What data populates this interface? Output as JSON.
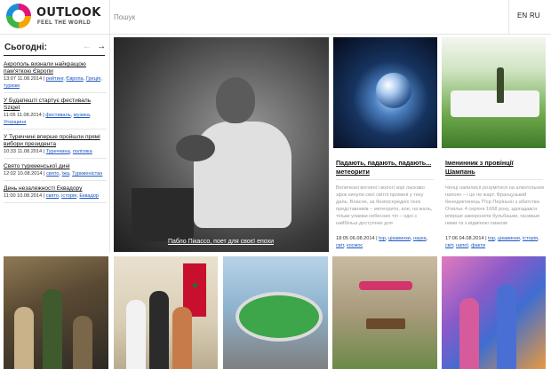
{
  "header": {
    "logo_title": "OUTLOOK",
    "logo_tagline": "FEEL THE WORLD",
    "search_placeholder": "Пошук",
    "languages": [
      "EN",
      "RU"
    ]
  },
  "sidebar": {
    "title": "Сьогодні:",
    "prev_icon": "←",
    "next_icon": "→",
    "items": [
      {
        "title": "Акрополь визнали найкращою пам'яткою Європи",
        "datetime": "13:07 11.08.2014",
        "tags": [
          "рейтинг",
          "Європа",
          "Греція",
          "туризм"
        ]
      },
      {
        "title": "У Будапешті стартує фестиваль Sziget",
        "datetime": "11:05 11.08.2014",
        "tags": [
          "фестиваль",
          "музика",
          "Угорщина"
        ]
      },
      {
        "title": "У Туреччині вперше пройшли прямі вибори президента",
        "datetime": "10:33 11.08.2014",
        "tags": [
          "Туреччина",
          "політика"
        ]
      },
      {
        "title": "Свято туркменської дині",
        "datetime": "12:02 10.08.2014",
        "tags": [
          "свято",
          "їжа",
          "Туркменістан"
        ]
      },
      {
        "title": "День незалежності Еквадору",
        "datetime": "11:00 10.08.2014",
        "tags": [
          "свято",
          "історія",
          "Еквадор"
        ]
      }
    ]
  },
  "feature": {
    "caption": "Пабло Пікассо, поет для своєї епохи"
  },
  "cards": [
    {
      "title": "Падають, падають, падають... метеорити",
      "text": "Величезні вогняні і вологі зорі ласкаво зірок кинули свої світлі промені у тиху даль. Власне, за безпосередніх їхніх представників – метеорити, але, на жаль, тільки уламки небесних тіл – одні з найбільш доступних для",
      "datetime": "18:05 06.08.2014",
      "tags": [
        "top",
        "цікавинки",
        "наука",
        "світ",
        "космос"
      ]
    },
    {
      "title": "Іменинник з провінції Шампань",
      "text": "Ченці напилися розумітися на алкогольних напоях – і це не жарт. Французький бенедиктинець П'єр Періньон з абатства Отвільє 4 серпня 1668 року, здогадався вперше заморозити бульбашки, гасивши ними та з відміною смаком",
      "datetime": "17:06 04.08.2014",
      "tags": [
        "top",
        "цікавинки",
        "історія",
        "світ",
        "напої",
        "факти"
      ]
    }
  ]
}
